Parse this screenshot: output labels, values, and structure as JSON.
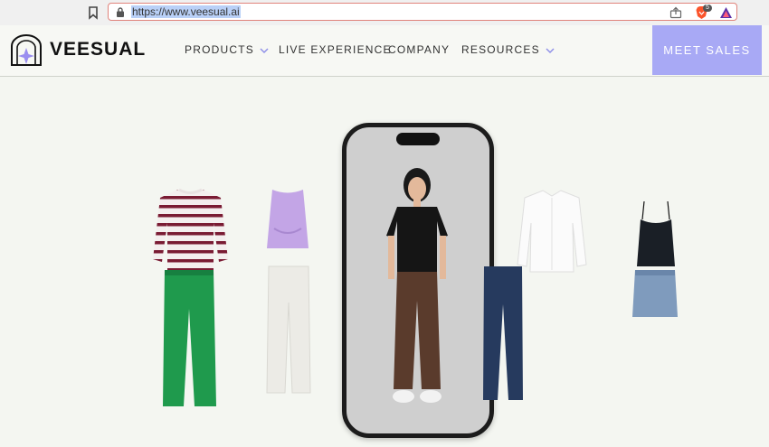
{
  "browser": {
    "url": "https://www.veesual.ai",
    "brave_badge": "5"
  },
  "nav": {
    "logo_text": "VEESUAL",
    "items": [
      {
        "label": "PRODUCTS",
        "has_dropdown": true
      },
      {
        "label": "LIVE EXPERIENCE",
        "has_dropdown": false
      },
      {
        "label": "COMPANY",
        "has_dropdown": false
      },
      {
        "label": "RESOURCES",
        "has_dropdown": true
      }
    ],
    "cta_label": "MEET SALES"
  },
  "colors": {
    "accent": "#a8a9f5",
    "page_bg": "#f4f6f1",
    "url_border": "#e0837b"
  },
  "icons": [
    "bookmark-icon",
    "lock-icon",
    "share-icon",
    "brave-lion-icon",
    "brave-rewards-icon",
    "veesual-logo-icon",
    "chevron-down-icon"
  ]
}
